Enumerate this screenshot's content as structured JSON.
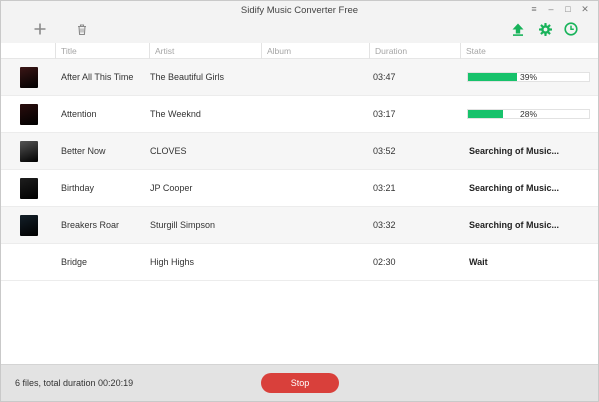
{
  "window": {
    "title": "Sidify Music Converter Free",
    "controls": {
      "menu": "≡",
      "minimize": "–",
      "maximize": "□",
      "close": "✕"
    }
  },
  "toolbar": {
    "add_icon": "plus-icon",
    "delete_icon": "trash-icon",
    "convert_icon": "upload-arrow-icon",
    "settings_icon": "gear-icon",
    "history_icon": "clock-icon",
    "accent_color": "#18b35a"
  },
  "columns": [
    "Title",
    "Artist",
    "Album",
    "Duration",
    "State"
  ],
  "tracks": [
    {
      "title": "After All This Time",
      "artist": "The Beautiful Girls",
      "album": "",
      "duration": "03:47",
      "state": "39%",
      "progress": 0.39,
      "cover": "#3b1616"
    },
    {
      "title": "Attention",
      "artist": "The Weeknd",
      "album": "",
      "duration": "03:17",
      "state": "28%",
      "progress": 0.28,
      "cover": "#2a0d0d"
    },
    {
      "title": "Better Now",
      "artist": "CLOVES",
      "album": "",
      "duration": "03:52",
      "state": "Searching of Music...",
      "progress": null,
      "cover": "#555555"
    },
    {
      "title": "Birthday",
      "artist": "JP Cooper",
      "album": "",
      "duration": "03:21",
      "state": "Searching of Music...",
      "progress": null,
      "cover": "#1e1e1e"
    },
    {
      "title": "Breakers Roar",
      "artist": "Sturgill Simpson",
      "album": "",
      "duration": "03:32",
      "state": "Searching of Music...",
      "progress": null,
      "cover": "#142029"
    },
    {
      "title": "Bridge",
      "artist": "High Highs",
      "album": "",
      "duration": "02:30",
      "state": "Wait",
      "progress": null,
      "cover": ""
    }
  ],
  "footer": {
    "summary": "6 files, total duration 00:20:19",
    "stop_label": "Stop",
    "stop_color": "#d9403b"
  }
}
